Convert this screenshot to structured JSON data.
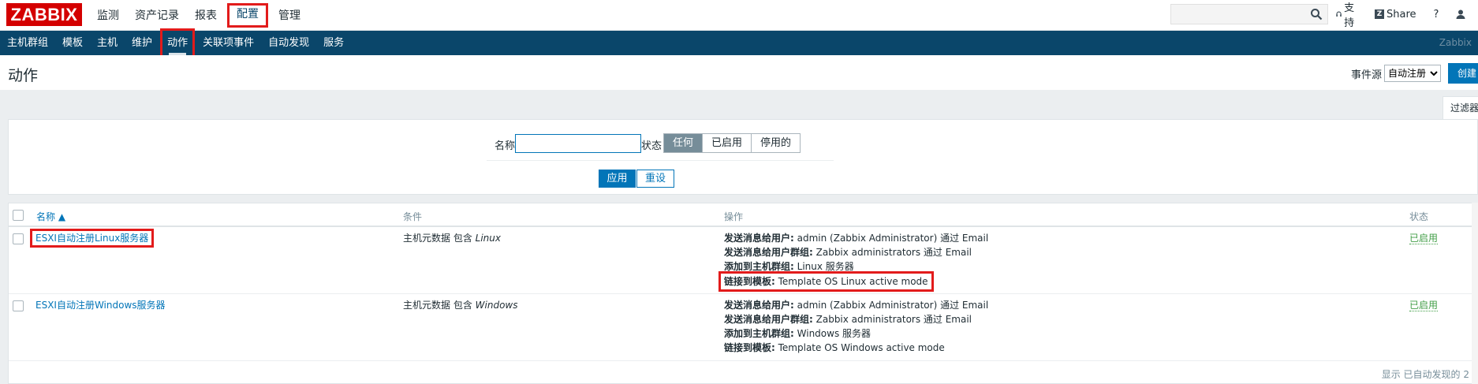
{
  "logo": "ZABBIX",
  "topnav": [
    {
      "label": "监测",
      "selected": false
    },
    {
      "label": "资产记录",
      "selected": false
    },
    {
      "label": "报表",
      "selected": false
    },
    {
      "label": "配置",
      "selected": true
    },
    {
      "label": "管理",
      "selected": false
    }
  ],
  "top_right": {
    "support_label": "支持",
    "share_label": "Share",
    "share_badge": "Z",
    "help_label": "?",
    "user_icon": "user-icon",
    "search_icon": "search-icon",
    "support_icon": "headset-icon"
  },
  "subnav": [
    {
      "label": "主机群组"
    },
    {
      "label": "模板"
    },
    {
      "label": "主机"
    },
    {
      "label": "维护"
    },
    {
      "label": "动作"
    },
    {
      "label": "关联项事件"
    },
    {
      "label": "自动发现"
    },
    {
      "label": "服务"
    }
  ],
  "subnav_brand": "Zabbix",
  "page_title": "动作",
  "event_source": {
    "label": "事件源",
    "selected": "自动注册"
  },
  "create_label": "创建",
  "filter": {
    "tab_label": "过滤器",
    "name_label": "名称",
    "name_value": "",
    "status_label": "状态",
    "status_options": [
      "任何",
      "已启用",
      "停用的"
    ],
    "status_active_index": 0,
    "apply_label": "应用",
    "reset_label": "重设"
  },
  "table": {
    "headers": {
      "name": "名称 ▲",
      "conditions": "条件",
      "operations": "操作",
      "status": "状态"
    },
    "rows": [
      {
        "name": "ESXI自动注册Linux服务器",
        "condition_prefix": "主机元数据 包含 ",
        "condition_value": "Linux",
        "operations": [
          {
            "label": "发送消息给用户:",
            "value": " admin (Zabbix Administrator) 通过 Email"
          },
          {
            "label": "发送消息给用户群组:",
            "value": " Zabbix administrators 通过 Email"
          },
          {
            "label": "添加到主机群组:",
            "value": " Linux 服务器"
          },
          {
            "label": "链接到模板:",
            "value": " Template OS Linux active mode"
          }
        ],
        "status": "已启用"
      },
      {
        "name": "ESXI自动注册Windows服务器",
        "condition_prefix": "主机元数据 包含 ",
        "condition_value": "Windows",
        "operations": [
          {
            "label": "发送消息给用户:",
            "value": " admin (Zabbix Administrator) 通过 Email"
          },
          {
            "label": "发送消息给用户群组:",
            "value": " Zabbix administrators 通过 Email"
          },
          {
            "label": "添加到主机群组:",
            "value": " Windows 服务器"
          },
          {
            "label": "链接到模板:",
            "value": " Template OS Windows active mode"
          }
        ],
        "status": "已启用"
      }
    ],
    "footer": "显示 已自动发现的 2"
  }
}
